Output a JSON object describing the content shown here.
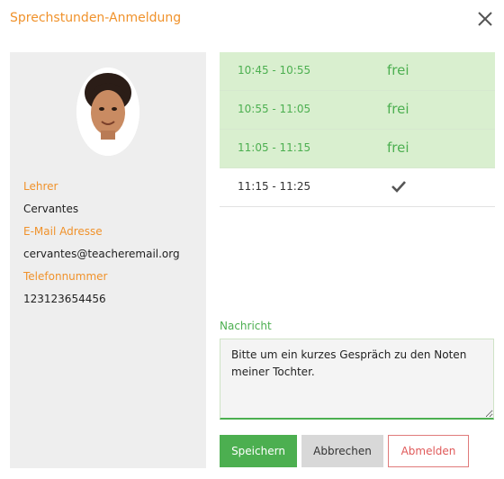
{
  "dialog": {
    "title": "Sprechstunden-Anmeldung",
    "close_icon": "close-icon"
  },
  "teacher": {
    "label_name": "Lehrer",
    "name": "Cervantes",
    "label_email": "E-Mail Adresse",
    "email": "cervantes@teacheremail.org",
    "label_phone": "Telefonnummer",
    "phone": "123123654456"
  },
  "slots": [
    {
      "time": "10:45 - 10:55",
      "status": "frei"
    },
    {
      "time": "10:55 - 11:05",
      "status": "frei"
    },
    {
      "time": "11:05 - 11:15",
      "status": "frei"
    },
    {
      "time": "11:15 - 11:25",
      "status": "",
      "icon": "checkmark-icon"
    }
  ],
  "message": {
    "label": "Nachricht",
    "value": "Bitte um ein kurzes Gespräch zu den Noten meiner Tochter."
  },
  "buttons": {
    "save": "Speichern",
    "cancel": "Abbrechen",
    "logout": "Abmelden"
  },
  "colors": {
    "accent_orange": "#f0922b",
    "accent_green": "#4caf50",
    "free_slot_bg": "#d9efcf",
    "danger": "#e05a5a"
  }
}
